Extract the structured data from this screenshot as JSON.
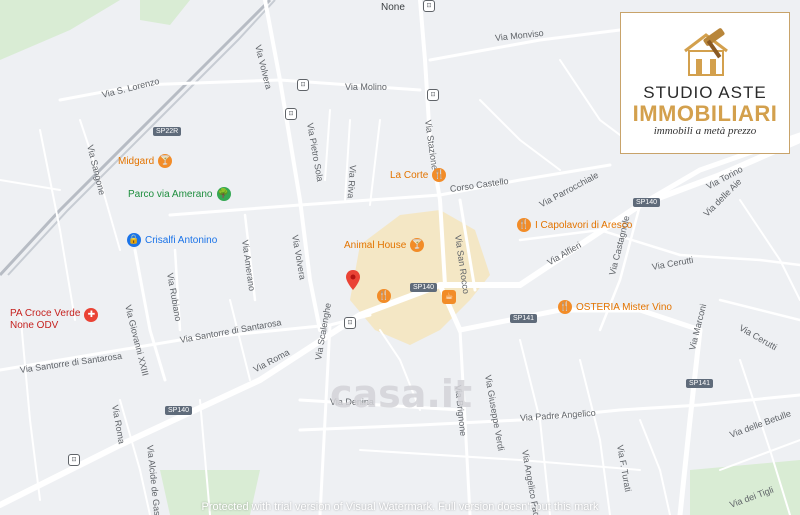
{
  "map": {
    "streets": [
      {
        "id": "via-volvera-1",
        "text": "Via Volvera"
      },
      {
        "id": "via-volvera-2",
        "text": "Via Volvera"
      },
      {
        "id": "via-molino",
        "text": "Via Molino"
      },
      {
        "id": "via-monviso",
        "text": "Via Monviso"
      },
      {
        "id": "via-s-lorenzo",
        "text": "Via S. Lorenzo"
      },
      {
        "id": "via-sangone",
        "text": "Via Sangone"
      },
      {
        "id": "via-pietro-sola",
        "text": "Via Pietro Sola"
      },
      {
        "id": "via-stazione",
        "text": "Via Stazione"
      },
      {
        "id": "via-riva",
        "text": "Via Riva"
      },
      {
        "id": "corso-castello",
        "text": "Corso Castello"
      },
      {
        "id": "via-parrocchiale",
        "text": "Via Parrocchiale"
      },
      {
        "id": "via-torino",
        "text": "Via Torino"
      },
      {
        "id": "via-delle-aie",
        "text": "Via delle Aie"
      },
      {
        "id": "via-alfieri",
        "text": "Via Alfieri"
      },
      {
        "id": "via-cerutti-1",
        "text": "Via Cerutti"
      },
      {
        "id": "via-cerutti-2",
        "text": "Via Cerutti"
      },
      {
        "id": "via-castagnole",
        "text": "Via Castagnole"
      },
      {
        "id": "via-marconi",
        "text": "Via Marconi"
      },
      {
        "id": "via-san-rocco",
        "text": "Via San Rocco"
      },
      {
        "id": "via-amerano",
        "text": "Via Amerano"
      },
      {
        "id": "via-rubiano",
        "text": "Via Rubiano"
      },
      {
        "id": "via-giovanni-xxiii",
        "text": "Via Giovanni XXIII"
      },
      {
        "id": "via-santorre-1",
        "text": "Via Santorre di Santarosa"
      },
      {
        "id": "via-santorre-2",
        "text": "Via Santorre di Santarosa"
      },
      {
        "id": "via-roma-1",
        "text": "Via Roma"
      },
      {
        "id": "via-roma-2",
        "text": "Via Roma"
      },
      {
        "id": "via-scalenghe",
        "text": "Via Scalenghe"
      },
      {
        "id": "via-denina",
        "text": "Via Denina"
      },
      {
        "id": "via-brignone",
        "text": "Via Brignone"
      },
      {
        "id": "via-giuseppe-verdi",
        "text": "Via Giuseppe Verdi"
      },
      {
        "id": "via-padre-angelico",
        "text": "Via Padre Angelico"
      },
      {
        "id": "via-angelico-padre",
        "text": "Via Angelico Padre"
      },
      {
        "id": "via-alcide",
        "text": "Via Alcide de Gasperi"
      },
      {
        "id": "via-f-turati",
        "text": "Via F. Turati"
      },
      {
        "id": "via-delle-betulle",
        "text": "Via delle Betulle"
      },
      {
        "id": "via-dei-tigli",
        "text": "Via dei Tigli"
      }
    ],
    "shields": [
      {
        "id": "sp22r",
        "text": "SP22R"
      },
      {
        "id": "sp140-a",
        "text": "SP140"
      },
      {
        "id": "sp140-b",
        "text": "SP140"
      },
      {
        "id": "sp140-c",
        "text": "SP140"
      },
      {
        "id": "sp141-a",
        "text": "SP141"
      },
      {
        "id": "sp141-b",
        "text": "SP141"
      }
    ],
    "places": {
      "none": "None",
      "midgard": "Midgard",
      "parco": "Parco via Amerano",
      "crisalfi": "Crisalfi Antonino",
      "la_corte": "La Corte",
      "animal_house": "Animal House",
      "capolavori": "I Capolavori di Aresco",
      "osteria": "OSTERIA Mister Vino",
      "pa_croce_line1": "PA Croce Verde",
      "pa_croce_line2": "None ODV"
    },
    "icons": {
      "restaurant": "🍴",
      "bar": "🍸",
      "park": "🌳",
      "shop": "🔒",
      "medical": "✚",
      "cafe": "☕",
      "station": "⊡"
    },
    "colors": {
      "road": "#ffffff",
      "background": "#eef0f3",
      "green_area": "#d9ecd4",
      "highlight": "#f7e3b1",
      "railway": "#b7bcc4",
      "pin": "#ea4335"
    }
  },
  "logo": {
    "line1": "STUDIO ASTE",
    "line2": "IMMOBILIARI",
    "line3": "immobili a metà prezzo"
  },
  "watermark": {
    "casa_text": "casa.it",
    "text": "Protected with trial version of Visual Watermark. Full version doesn't put this mark"
  }
}
